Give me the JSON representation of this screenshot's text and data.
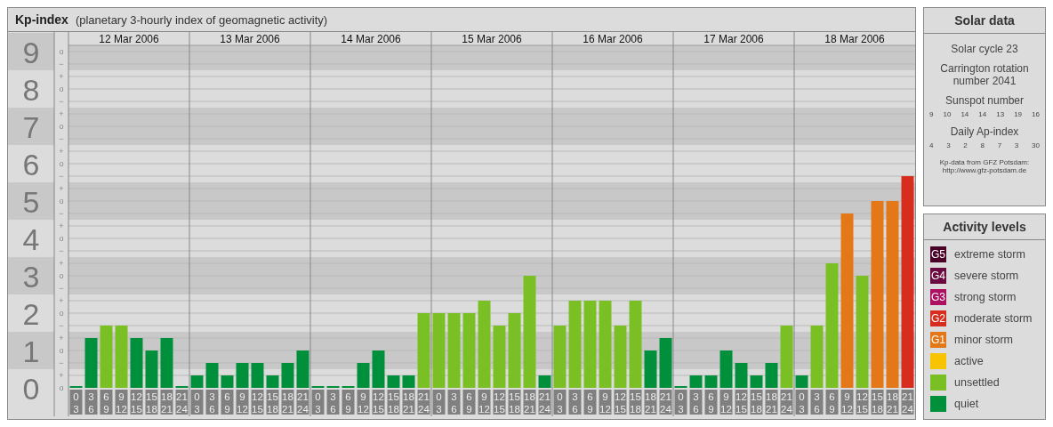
{
  "kp_panel": {
    "title": "Kp-index",
    "subtitle": "(planetary 3-hourly index of geomagnetic activity)",
    "days": [
      "12 Mar 2006",
      "13 Mar 2006",
      "14 Mar 2006",
      "15 Mar 2006",
      "16 Mar 2006",
      "17 Mar 2006",
      "18 Mar 2006"
    ],
    "chart_data": {
      "type": "bar",
      "grid": true,
      "categories": [
        [
          "0",
          "3"
        ],
        [
          "3",
          "6"
        ],
        [
          "6",
          "9"
        ],
        [
          "9",
          "12"
        ],
        [
          "12",
          "15"
        ],
        [
          "15",
          "18"
        ],
        [
          "18",
          "21"
        ],
        [
          "21",
          "24"
        ],
        [
          "0",
          "3"
        ],
        [
          "3",
          "6"
        ],
        [
          "6",
          "9"
        ],
        [
          "9",
          "12"
        ],
        [
          "12",
          "15"
        ],
        [
          "15",
          "18"
        ],
        [
          "18",
          "21"
        ],
        [
          "21",
          "24"
        ],
        [
          "0",
          "3"
        ],
        [
          "3",
          "6"
        ],
        [
          "6",
          "9"
        ],
        [
          "9",
          "12"
        ],
        [
          "12",
          "15"
        ],
        [
          "15",
          "18"
        ],
        [
          "18",
          "21"
        ],
        [
          "21",
          "24"
        ],
        [
          "0",
          "3"
        ],
        [
          "3",
          "6"
        ],
        [
          "6",
          "9"
        ],
        [
          "9",
          "12"
        ],
        [
          "12",
          "15"
        ],
        [
          "15",
          "18"
        ],
        [
          "18",
          "21"
        ],
        [
          "21",
          "24"
        ],
        [
          "0",
          "3"
        ],
        [
          "3",
          "6"
        ],
        [
          "6",
          "9"
        ],
        [
          "9",
          "12"
        ],
        [
          "12",
          "15"
        ],
        [
          "15",
          "18"
        ],
        [
          "18",
          "21"
        ],
        [
          "21",
          "24"
        ],
        [
          "0",
          "3"
        ],
        [
          "3",
          "6"
        ],
        [
          "6",
          "9"
        ],
        [
          "9",
          "12"
        ],
        [
          "12",
          "15"
        ],
        [
          "15",
          "18"
        ],
        [
          "18",
          "21"
        ],
        [
          "21",
          "24"
        ],
        [
          "0",
          "3"
        ],
        [
          "3",
          "6"
        ],
        [
          "6",
          "9"
        ],
        [
          "9",
          "12"
        ],
        [
          "12",
          "15"
        ],
        [
          "15",
          "18"
        ],
        [
          "18",
          "21"
        ],
        [
          "21",
          "24"
        ]
      ],
      "series": [
        {
          "values": [
            0,
            1.33,
            1.67,
            1.67,
            1.33,
            1,
            1.33,
            0,
            0.33,
            0.67,
            0.33,
            0.67,
            0.67,
            0.33,
            0.67,
            1,
            0,
            0,
            0,
            0.67,
            1,
            0.33,
            0.33,
            2,
            2,
            2,
            2,
            2.33,
            1.67,
            2,
            3,
            0.33,
            1.67,
            2.33,
            2.33,
            2.33,
            1.67,
            2.33,
            1,
            1.33,
            0,
            0.33,
            0.33,
            1,
            0.67,
            0.33,
            0.67,
            1.67,
            0.33,
            1.67,
            3.33,
            4.67,
            3,
            5,
            5,
            5.67
          ]
        }
      ],
      "ylim": [
        0,
        9
      ],
      "yticks": [
        0,
        1,
        2,
        3,
        4,
        5,
        6,
        7,
        8,
        9
      ]
    },
    "subdivision_labels": [
      "o",
      "−",
      "+",
      "o",
      "−",
      "+",
      "o",
      "−",
      "+",
      "o",
      "−",
      "+",
      "o",
      "−",
      "+",
      "o",
      "−",
      "+",
      "o",
      "−",
      "+",
      "o",
      "−",
      "+",
      "o",
      "−",
      "+",
      "o"
    ]
  },
  "solar_data": {
    "title": "Solar data",
    "cycle": "Solar cycle 23",
    "rotation": "Carrington rotation number 2041",
    "sunspot_label": "Sunspot number",
    "sunspot_numbers": [
      "9",
      "10",
      "14",
      "14",
      "13",
      "19",
      "16"
    ],
    "ap_label": "Daily Ap-index",
    "ap_values": [
      "4",
      "3",
      "2",
      "8",
      "7",
      "3",
      "30"
    ],
    "source": "Kp-data from GFZ Potsdam:",
    "source_url": "http://www.gfz-potsdam.de"
  },
  "activity_levels": {
    "title": "Activity levels",
    "items": [
      {
        "badge": "G5",
        "label": "extreme storm",
        "color": "#4a0026"
      },
      {
        "badge": "G4",
        "label": "severe storm",
        "color": "#6a0a3e"
      },
      {
        "badge": "G3",
        "label": "strong storm",
        "color": "#ae0f60"
      },
      {
        "badge": "G2",
        "label": "moderate storm",
        "color": "#d82c1e"
      },
      {
        "badge": "G1",
        "label": "minor storm",
        "color": "#e47818"
      },
      {
        "label": "active",
        "color": "#f8c400"
      },
      {
        "label": "unsettled",
        "color": "#7ac024"
      },
      {
        "label": "quiet",
        "color": "#00903c"
      }
    ]
  }
}
